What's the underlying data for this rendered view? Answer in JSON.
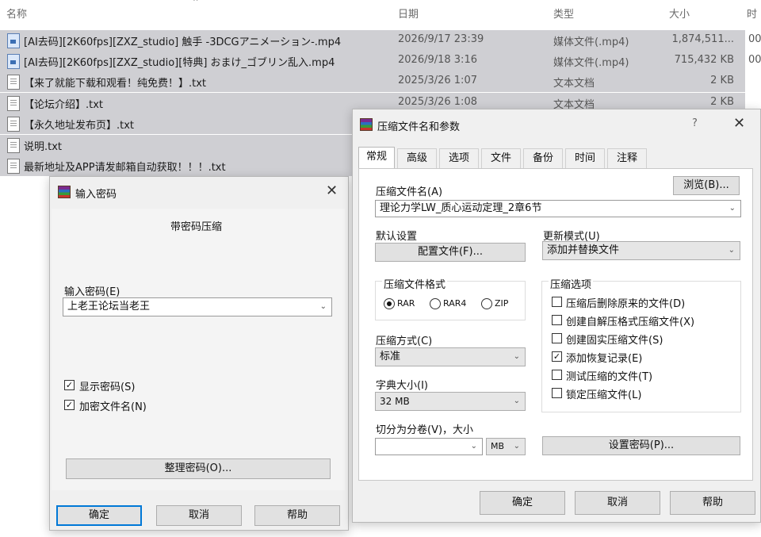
{
  "explorer": {
    "headers": {
      "name": "名称",
      "date": "日期",
      "type": "类型",
      "size": "大小",
      "extra": "时"
    },
    "files": [
      {
        "name": "[AI去码][2K60fps][ZXZ_studio] 触手 -3DCGアニメーション-.mp4",
        "date": "2026/9/17 23:39",
        "type": "媒体文件(.mp4)",
        "size": "1,874,511...",
        "extra": "00",
        "icon": "media-file-icon",
        "selected": true
      },
      {
        "name": "[AI去码][2K60fps][ZXZ_studio][特典] おまけ_ゴブリン乱入.mp4",
        "date": "2026/9/18 3:16",
        "type": "媒体文件(.mp4)",
        "size": "715,432 KB",
        "extra": "00",
        "icon": "media-file-icon",
        "selected": true
      },
      {
        "name": "【来了就能下载和观看！纯免费！】.txt",
        "date": "2025/3/26 1:07",
        "type": "文本文档",
        "size": "2 KB",
        "extra": "",
        "icon": "text-file-icon",
        "selected": true
      },
      {
        "name": "【论坛介绍】.txt",
        "date": "2025/3/26 1:08",
        "type": "文本文档",
        "size": "2 KB",
        "extra": "",
        "icon": "text-file-icon",
        "selected": true
      },
      {
        "name": "【永久地址发布页】.txt",
        "date": "",
        "type": "",
        "size": "",
        "extra": "",
        "icon": "text-file-icon",
        "selected": true
      },
      {
        "name": "说明.txt",
        "date": "",
        "type": "",
        "size": "",
        "extra": "",
        "icon": "text-file-icon",
        "selected": true
      },
      {
        "name": "最新地址及APP请发邮箱自动获取！！！.txt",
        "date": "",
        "type": "",
        "size": "",
        "extra": "",
        "icon": "text-file-icon",
        "selected": true
      }
    ]
  },
  "password_dialog": {
    "title": "输入密码",
    "heading": "带密码压缩",
    "password_label": "输入密码(E)",
    "password_value": "上老王论坛当老王",
    "show_password": {
      "label": "显示密码(S)",
      "checked": true
    },
    "encrypt_names": {
      "label": "加密文件名(N)",
      "checked": true
    },
    "organize_button": "整理密码(O)...",
    "ok_button": "确定",
    "cancel_button": "取消",
    "help_button": "帮助"
  },
  "archive_dialog": {
    "title": "压缩文件名和参数",
    "help_glyph": "?",
    "tabs": [
      "常规",
      "高级",
      "选项",
      "文件",
      "备份",
      "时间",
      "注释"
    ],
    "archive_name_label": "压缩文件名(A)",
    "browse_button": "浏览(B)...",
    "archive_name_value": "理论力学LW_质心运动定理_2章6节",
    "default_settings_label": "默认设置",
    "profiles_button": "配置文件(F)...",
    "update_mode_label": "更新模式(U)",
    "update_mode_value": "添加并替换文件",
    "format_group_label": "压缩文件格式",
    "formats": [
      {
        "label": "RAR",
        "selected": true
      },
      {
        "label": "RAR4",
        "selected": false
      },
      {
        "label": "ZIP",
        "selected": false
      }
    ],
    "method_label": "压缩方式(C)",
    "method_value": "标准",
    "dict_label": "字典大小(I)",
    "dict_value": "32 MB",
    "split_label": "切分为分卷(V)，大小",
    "split_value": "",
    "split_unit": "MB",
    "options_group_label": "压缩选项",
    "options": [
      {
        "label": "压缩后删除原来的文件(D)",
        "checked": false
      },
      {
        "label": "创建自解压格式压缩文件(X)",
        "checked": false
      },
      {
        "label": "创建固实压缩文件(S)",
        "checked": false
      },
      {
        "label": "添加恢复记录(E)",
        "checked": true
      },
      {
        "label": "测试压缩的文件(T)",
        "checked": false
      },
      {
        "label": "锁定压缩文件(L)",
        "checked": false
      }
    ],
    "set_password_button": "设置密码(P)...",
    "ok_button": "确定",
    "cancel_button": "取消",
    "help_button": "帮助"
  },
  "colors": {
    "selection": "#cfcfd3",
    "dialog_bg": "#f0f0f0",
    "focus_border": "#0078d7"
  }
}
